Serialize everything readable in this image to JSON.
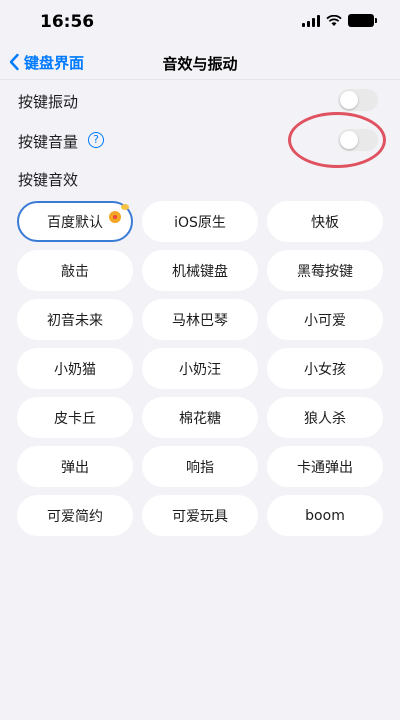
{
  "status_bar": {
    "time": "16:56",
    "icons": [
      "signal-icon",
      "wifi-icon",
      "battery-icon"
    ]
  },
  "nav": {
    "back_label": "键盘界面",
    "title": "音效与振动"
  },
  "settings": {
    "vibration": {
      "label": "按键振动",
      "enabled": false
    },
    "volume": {
      "label": "按键音量",
      "enabled": false,
      "help_icon": "?"
    }
  },
  "sound_section": {
    "label": "按键音效",
    "selected": "百度默认",
    "items": [
      "百度默认",
      "iOS原生",
      "快板",
      "敲击",
      "机械键盘",
      "黑莓按键",
      "初音未来",
      "马林巴琴",
      "小可爱",
      "小奶猫",
      "小奶汪",
      "小女孩",
      "皮卡丘",
      "棉花糖",
      "狼人杀",
      "弹出",
      "响指",
      "卡通弹出",
      "可爱简约",
      "可爱玩具",
      "boom"
    ]
  },
  "colors": {
    "accent": "#007aff",
    "annotation": "#e05260",
    "background": "#f2f2f7",
    "selected_border": "#3a7bd5"
  }
}
